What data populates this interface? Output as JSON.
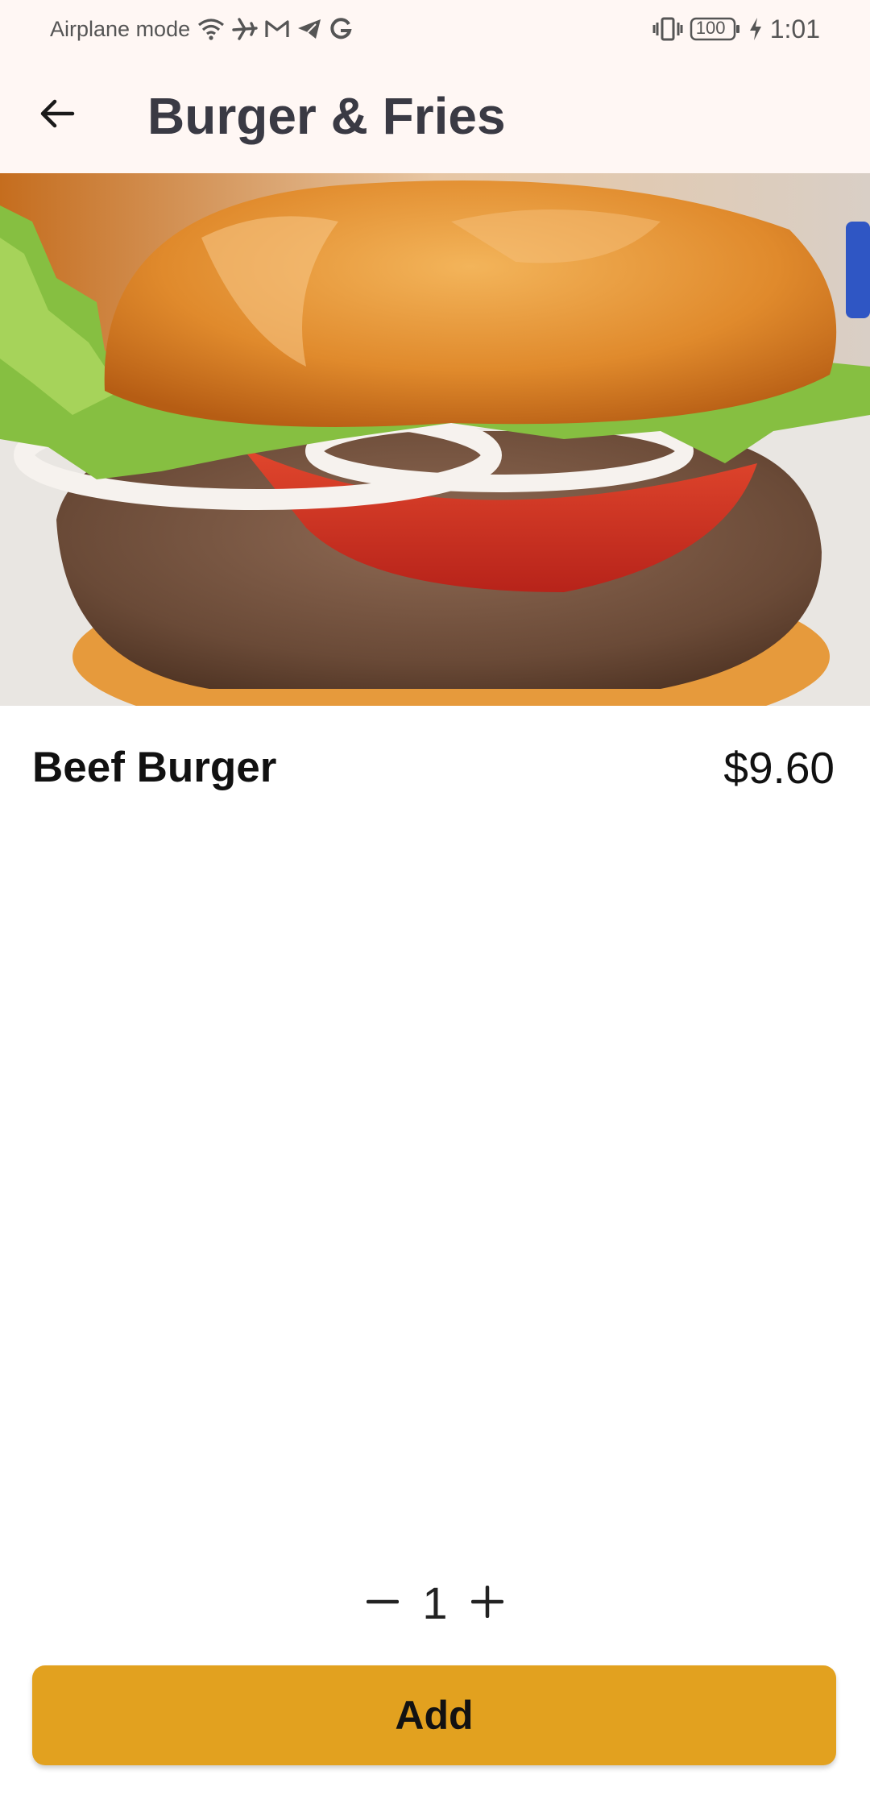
{
  "status_bar": {
    "carrier_text": "Airplane mode",
    "battery": "100",
    "time": "1:01",
    "icons": [
      "wifi-icon",
      "airplane-icon",
      "gmail-icon",
      "telegram-icon",
      "google-icon",
      "vibrate-icon",
      "battery-icon",
      "charging-icon"
    ]
  },
  "app_bar": {
    "title": "Burger & Fries",
    "back_icon": "arrow-left-icon"
  },
  "item": {
    "image": "beef-burger-photo",
    "name": "Beef Burger",
    "price": "$9.60"
  },
  "quantity": {
    "value": "1",
    "decrement_icon": "minus-icon",
    "increment_icon": "plus-icon"
  },
  "actions": {
    "add_label": "Add"
  },
  "colors": {
    "header_bg": "#fff7f4",
    "accent": "#e2a11f",
    "title_text": "#3a3a44"
  }
}
